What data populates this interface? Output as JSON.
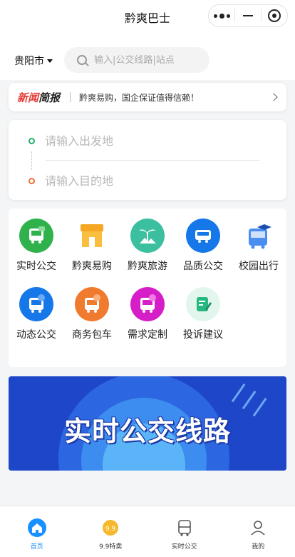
{
  "header": {
    "title": "黔爽巴士"
  },
  "search": {
    "city": "贵阳市",
    "placeholder": "输入|公交线路|站点"
  },
  "news": {
    "tag_red": "新闻",
    "tag_dark": "简报",
    "text": "黔爽易购，国企保证值得信赖！"
  },
  "route": {
    "from_placeholder": "请输入出发地",
    "to_placeholder": "请输入目的地"
  },
  "services": [
    {
      "label": "实时公交",
      "icon": "realtime-bus-icon",
      "color": "#2fb24c"
    },
    {
      "label": "黔爽易购",
      "icon": "shop-icon",
      "color": "#f5a623"
    },
    {
      "label": "黔爽旅游",
      "icon": "palm-tree-icon",
      "color": "#3bbf9e"
    },
    {
      "label": "品质公交",
      "icon": "quality-bus-icon",
      "color": "#1677e8"
    },
    {
      "label": "校园出行",
      "icon": "campus-bus-icon",
      "color": "#4a8ff0"
    },
    {
      "label": "动态公交",
      "icon": "dynamic-bus-icon",
      "color": "#1677e8"
    },
    {
      "label": "商务包车",
      "icon": "charter-bus-icon",
      "color": "#f07a2e"
    },
    {
      "label": "需求定制",
      "icon": "custom-bus-icon",
      "color": "#d61ec8"
    },
    {
      "label": "投诉建议",
      "icon": "feedback-icon",
      "color": "#27b882"
    }
  ],
  "banner": {
    "headline": "实时公交线路"
  },
  "tabbar": [
    {
      "label": "首页",
      "icon": "home-icon",
      "active": true
    },
    {
      "label": "9.9特卖",
      "icon": "sale-badge-icon",
      "active": false
    },
    {
      "label": "实时公交",
      "icon": "bus-tab-icon",
      "active": false
    },
    {
      "label": "我的",
      "icon": "profile-icon",
      "active": false
    }
  ],
  "colors": {
    "accent": "#1890ff",
    "news_red": "#e53935",
    "start_dot": "#20b26a",
    "end_dot": "#f0703c"
  }
}
